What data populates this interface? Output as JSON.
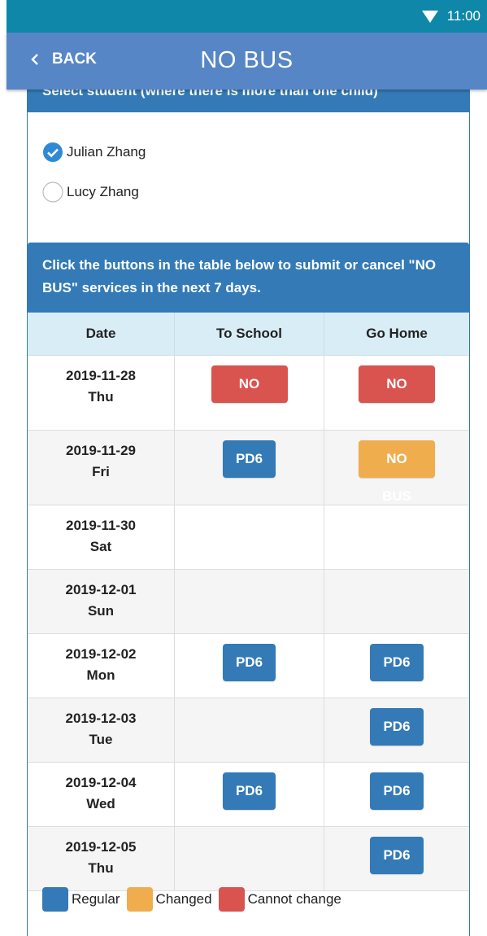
{
  "status": {
    "time": "11:00"
  },
  "header": {
    "back_label": "BACK",
    "title": "NO BUS"
  },
  "select": {
    "heading": "Select student (where there is more than one child)"
  },
  "students": [
    {
      "name": "Julian Zhang",
      "checked": true
    },
    {
      "name": "Lucy Zhang",
      "checked": false
    }
  ],
  "instructions": "Click the buttons in the table below to submit or cancel \"NO BUS\" services in the next 7 days.",
  "table": {
    "headers": [
      "Date",
      "To School",
      "Go Home"
    ],
    "rows": [
      {
        "date": "2019-11-28",
        "day": "Thu",
        "to_school": "NO BUS",
        "to_school_state": "cannot-change",
        "go_home": "NO BUS",
        "go_home_state": "cannot-change"
      },
      {
        "date": "2019-11-29",
        "day": "Fri",
        "to_school": "PD6",
        "to_school_state": "regular",
        "go_home": "NO BUS",
        "go_home_state": "changed"
      },
      {
        "date": "2019-11-30",
        "day": "Sat",
        "to_school": "",
        "go_home": ""
      },
      {
        "date": "2019-12-01",
        "day": "Sun",
        "to_school": "",
        "go_home": ""
      },
      {
        "date": "2019-12-02",
        "day": "Mon",
        "to_school": "PD6",
        "to_school_state": "regular",
        "go_home": "PD6",
        "go_home_state": "regular"
      },
      {
        "date": "2019-12-03",
        "day": "Tue",
        "to_school": "",
        "go_home": "PD6",
        "go_home_state": "regular"
      },
      {
        "date": "2019-12-04",
        "day": "Wed",
        "to_school": "PD6",
        "to_school_state": "regular",
        "go_home": "PD6",
        "go_home_state": "regular"
      },
      {
        "date": "2019-12-05",
        "day": "Thu",
        "to_school": "",
        "go_home": "PD6",
        "go_home_state": "regular"
      }
    ]
  },
  "legend": [
    {
      "label": "Regular",
      "color": "#337ab7"
    },
    {
      "label": "Changed",
      "color": "#f0ad4e"
    },
    {
      "label": "Cannot change",
      "color": "#d9534f"
    }
  ],
  "colors": {
    "regular": "#337ab7",
    "changed": "#f0ad4e",
    "cannot-change": "#d9534f",
    "checked": "#2f8ad6"
  }
}
